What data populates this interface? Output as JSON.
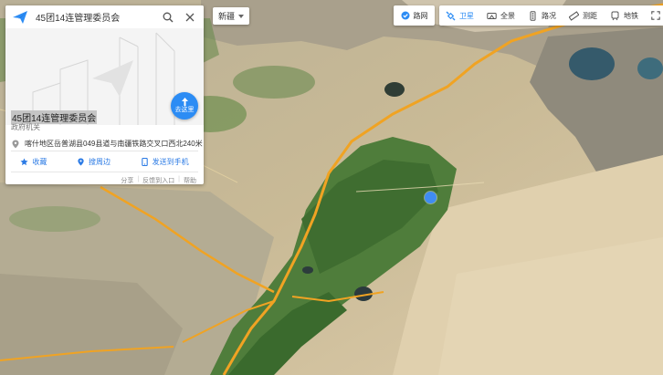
{
  "search": {
    "query": "45团14连管理委员会"
  },
  "poi": {
    "name": "45团14连管理委员会",
    "type": "政府机关",
    "address": "喀什地区岳普湖县049县道与南疆铁路交叉口西北240米",
    "route_label": "去这里"
  },
  "actions": [
    {
      "label": "收藏",
      "icon": "star-icon"
    },
    {
      "label": "搜周边",
      "icon": "location-pin-icon"
    },
    {
      "label": "发送到手机",
      "icon": "phone-icon"
    }
  ],
  "bottom_links": [
    "分享",
    "反馈到入口",
    "帮助"
  ],
  "region": {
    "label": "新疆"
  },
  "toolbar": {
    "traffic": "路网",
    "items": [
      {
        "label": "卫星",
        "icon": "satellite-icon",
        "active": true
      },
      {
        "label": "全景",
        "icon": "panorama-icon",
        "active": false
      },
      {
        "label": "路况",
        "icon": "traffic-icon",
        "active": false
      },
      {
        "label": "测距",
        "icon": "ruler-icon",
        "active": false
      },
      {
        "label": "地铁",
        "icon": "subway-icon",
        "active": false
      }
    ]
  },
  "colors": {
    "accent": "#2c8cf4",
    "road": "#f0a323",
    "desert": "#d8c8a4",
    "oasis": "#4e7a3a"
  }
}
